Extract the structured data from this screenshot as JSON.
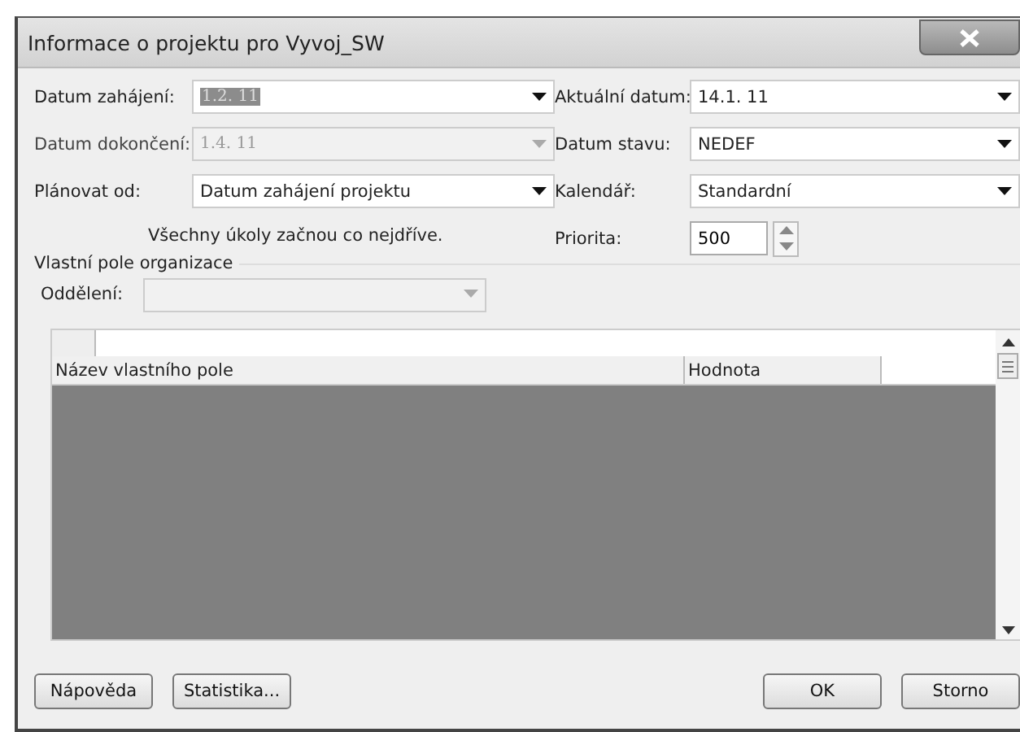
{
  "window": {
    "title": "Informace o projektu pro Vyvoj_SW"
  },
  "left_fields": [
    {
      "label": "Datum zahájení:",
      "value": "1.2. 11",
      "disabled": false,
      "value_selected": true
    },
    {
      "label": "Datum dokončení:",
      "value": "1.4. 11",
      "disabled": true,
      "value_selected": false
    },
    {
      "label": "Plánovat od:",
      "value": "Datum zahájení projektu",
      "disabled": false,
      "value_selected": false
    }
  ],
  "right_fields": [
    {
      "label": "Aktuální datum:",
      "value": "14.1. 11",
      "disabled": false,
      "value_selected": false
    },
    {
      "label": "Datum stavu:",
      "value": "NEDEF",
      "disabled": false,
      "value_selected": false
    },
    {
      "label": "Kalendář:",
      "value": "Standardní",
      "disabled": false,
      "value_selected": false
    }
  ],
  "note": "Všechny úkoly začnou co nejdříve.",
  "priority": {
    "label": "Priorita:",
    "value": "500"
  },
  "group": {
    "legend": "Vlastní pole organizace",
    "department": {
      "label": "Oddělení:",
      "disabled": true
    },
    "table": {
      "columns": [
        "Název vlastního pole",
        "Hodnota"
      ]
    }
  },
  "left_buttons": [
    "Nápověda",
    "Statistika..."
  ],
  "right_buttons": [
    "OK",
    "Storno"
  ]
}
